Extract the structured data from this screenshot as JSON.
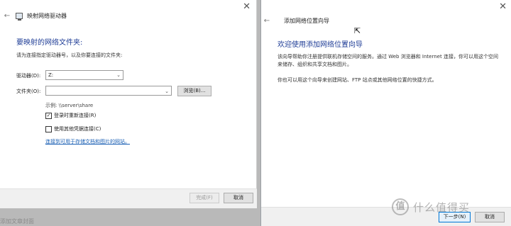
{
  "map_drive": {
    "title": "映射网络驱动器",
    "heading": "要映射的网络文件夹:",
    "subtitle": "请为连接指定驱动器号，以及你要连接的文件夹:",
    "drive_label": "驱动器(D):",
    "drive_value": "Z:",
    "folder_label": "文件夹(O):",
    "folder_value": "",
    "browse_label": "浏览(B)...",
    "example": "示例: \\\\server\\share",
    "reconnect_label": "登录时重新连接(R)",
    "reconnect_checked": "✓",
    "other_creds_label": "使用其他凭据连接(C)",
    "other_creds_checked": "",
    "link_text": "连接到可用于存储文档和图片的网站。",
    "finish_label": "完成(F)",
    "cancel_label": "取消"
  },
  "add_location": {
    "title": "添加网络位置向导",
    "heading": "欢迎使用添加网络位置向导",
    "para1": "该向导帮助你注册提供联机存储空间的服务。通过 Web 浏览器和 Internet 连接，你可以用这个空间来储存、组织和共享文档和图片。",
    "para2": "你也可以用这个向导来创建网站、FTP 站点或其他网络位置的快捷方式。",
    "next_label": "下一步(N)",
    "cancel_label": "取消"
  },
  "background": {
    "text": "添加文章封面"
  },
  "watermark": {
    "badge": "值",
    "text": "什么值得买"
  },
  "icons": {
    "close": "close-icon",
    "back": "back-arrow-icon",
    "network_drive": "network-drive-icon",
    "chevron": "chevron-down-icon",
    "cursor": "mouse-cursor-icon"
  }
}
